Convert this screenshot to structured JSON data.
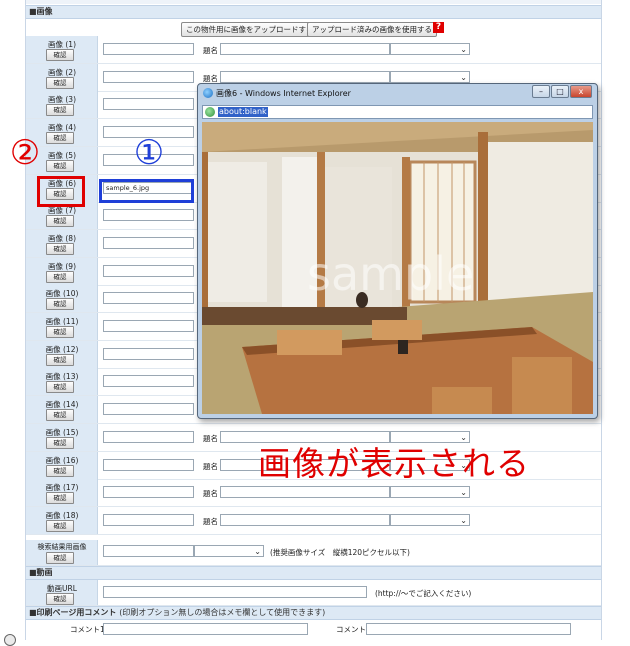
{
  "sections": {
    "image": "■画像",
    "video": "■動画",
    "print_comment": "■印刷ページ用コメント",
    "print_comment_note": "(印刷オプション無しの場合はメモ欄として使用できます)"
  },
  "toolbar": {
    "upload_label": "この物件用に画像をアップロードする",
    "use_uploaded_label": "アップロード済みの画像を使用する",
    "help_label": "?"
  },
  "image_rows": [
    {
      "label": "画像 (1)",
      "confirm": "確認",
      "file": "",
      "title_label": "題名"
    },
    {
      "label": "画像 (2)",
      "confirm": "確認",
      "file": "",
      "title_label": "題名"
    },
    {
      "label": "画像 (3)",
      "confirm": "確認",
      "file": "",
      "title_label": ""
    },
    {
      "label": "画像 (4)",
      "confirm": "確認",
      "file": "",
      "title_label": ""
    },
    {
      "label": "画像 (5)",
      "confirm": "確認",
      "file": "",
      "title_label": ""
    },
    {
      "label": "画像 (6)",
      "confirm": "確認",
      "file": "sample_6.jpg",
      "title_label": ""
    },
    {
      "label": "画像 (7)",
      "confirm": "確認",
      "file": "",
      "title_label": ""
    },
    {
      "label": "画像 (8)",
      "confirm": "確認",
      "file": "",
      "title_label": ""
    },
    {
      "label": "画像 (9)",
      "confirm": "確認",
      "file": "",
      "title_label": ""
    },
    {
      "label": "画像 (10)",
      "confirm": "確認",
      "file": "",
      "title_label": ""
    },
    {
      "label": "画像 (11)",
      "confirm": "確認",
      "file": "",
      "title_label": ""
    },
    {
      "label": "画像 (12)",
      "confirm": "確認",
      "file": "",
      "title_label": ""
    },
    {
      "label": "画像 (13)",
      "confirm": "確認",
      "file": "",
      "title_label": ""
    },
    {
      "label": "画像 (14)",
      "confirm": "確認",
      "file": "",
      "title_label": ""
    },
    {
      "label": "画像 (15)",
      "confirm": "確認",
      "file": "",
      "title_label": "題名"
    },
    {
      "label": "画像 (16)",
      "confirm": "確認",
      "file": "",
      "title_label": "題名"
    },
    {
      "label": "画像 (17)",
      "confirm": "確認",
      "file": "",
      "title_label": "題名"
    },
    {
      "label": "画像 (18)",
      "confirm": "確認",
      "file": "",
      "title_label": "題名"
    }
  ],
  "search_image": {
    "label": "検索結果用画像",
    "confirm": "確認",
    "hint": "(推奨画像サイズ　縦横120ピクセル以下)"
  },
  "video": {
    "label": "動画URL",
    "confirm": "確認",
    "hint": "(http://～でご記入ください)"
  },
  "print_comment": {
    "comment1": "コメント1",
    "comment2": "コメント2"
  },
  "popup": {
    "title": "画像6 - Windows Internet Explorer",
    "address": "about:blank",
    "watermark": "sample",
    "minimize": "–",
    "maximize": "□",
    "close": "x"
  },
  "annotations": {
    "step1": "①",
    "step2": "②",
    "caption": "画像が表示される"
  },
  "colors": {
    "label_bg": "#dde9f5",
    "annotation_red": "#e00000",
    "annotation_blue": "#1f3fd8"
  }
}
